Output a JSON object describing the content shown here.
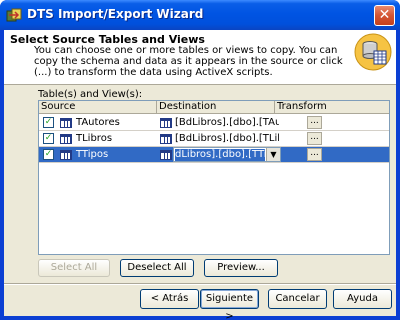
{
  "window": {
    "title": "DTS Import/Export Wizard",
    "close_glyph": "✕"
  },
  "header": {
    "title": "Select Source Tables and Views",
    "description": "You can choose one or more tables or views to copy.  You can copy the schema and data as it appears in the source or click (...) to transform the data using ActiveX scripts.",
    "icon": "database-tables-icon"
  },
  "tables_label": "Table(s) and View(s):",
  "grid": {
    "columns": [
      "Source",
      "Destination",
      "Transform"
    ],
    "rows": [
      {
        "checked": true,
        "source": "TAutores",
        "destination": "[BdLibros].[dbo].[TAutores]",
        "transform": "...",
        "selected": false
      },
      {
        "checked": true,
        "source": "TLibros",
        "destination": "[BdLibros].[dbo].[TLibros]",
        "transform": "...",
        "selected": false
      },
      {
        "checked": true,
        "source": "TTipos",
        "destination": "dLibros].[dbo].[TTipos]",
        "transform": "...",
        "selected": true
      }
    ]
  },
  "buttons": {
    "select_all": "Select All",
    "deselect_all": "Deselect All",
    "preview": "Preview...",
    "back": "< Atrás",
    "next": "Siguiente >",
    "cancel": "Cancelar",
    "help": "Ayuda"
  },
  "colors": {
    "titlebar": "#0054e3",
    "selection": "#316ac5",
    "panel": "#ece9d8"
  }
}
